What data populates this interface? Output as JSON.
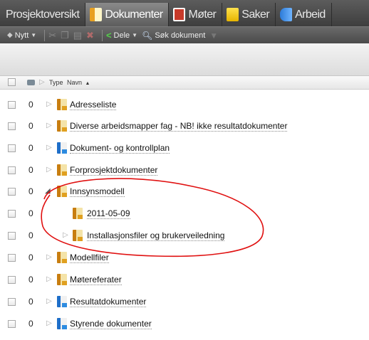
{
  "tabs": [
    {
      "label": "Prosjektoversikt",
      "icon": "",
      "active": false
    },
    {
      "label": "Dokumenter",
      "icon": "document-folder-icon",
      "active": true
    },
    {
      "label": "Møter",
      "icon": "calendar-icon",
      "active": false
    },
    {
      "label": "Saker",
      "icon": "note-icon",
      "active": false
    },
    {
      "label": "Arbeid",
      "icon": "workflow-icon",
      "active": false
    }
  ],
  "toolbar": {
    "new_label": "Nytt",
    "share_label": "Dele",
    "search_label": "Søk dokument"
  },
  "header": {
    "type_label": "Type",
    "name_label": "Navn",
    "sort_indicator": "▲"
  },
  "rows": [
    {
      "count": "0",
      "name": "Adresseliste",
      "color": "yellow",
      "expand": "collapsed"
    },
    {
      "count": "0",
      "name": "Diverse arbeidsmapper fag - NB! ikke resultatdokumenter",
      "color": "yellow",
      "expand": "collapsed"
    },
    {
      "count": "0",
      "name": "Dokument- og kontrollplan",
      "color": "blue",
      "expand": "collapsed"
    },
    {
      "count": "0",
      "name": "Forprosjektdokumenter",
      "color": "yellow",
      "expand": "collapsed"
    },
    {
      "count": "0",
      "name": "Innsynsmodell",
      "color": "yellow",
      "expand": "expanded"
    },
    {
      "count": "0",
      "name": "2011-05-09",
      "color": "yellow",
      "expand": "none"
    },
    {
      "count": "0",
      "name": "Installasjonsfiler og brukerveiledning",
      "color": "yellow",
      "expand": "collapsed"
    },
    {
      "count": "0",
      "name": "Modellfiler",
      "color": "yellow",
      "expand": "collapsed"
    },
    {
      "count": "0",
      "name": "Møtereferater",
      "color": "yellow",
      "expand": "collapsed"
    },
    {
      "count": "0",
      "name": "Resultatdokumenter",
      "color": "blue",
      "expand": "collapsed"
    },
    {
      "count": "0",
      "name": "Styrende dokumenter",
      "color": "blue",
      "expand": "collapsed"
    }
  ],
  "annotation_color": "#e01010"
}
